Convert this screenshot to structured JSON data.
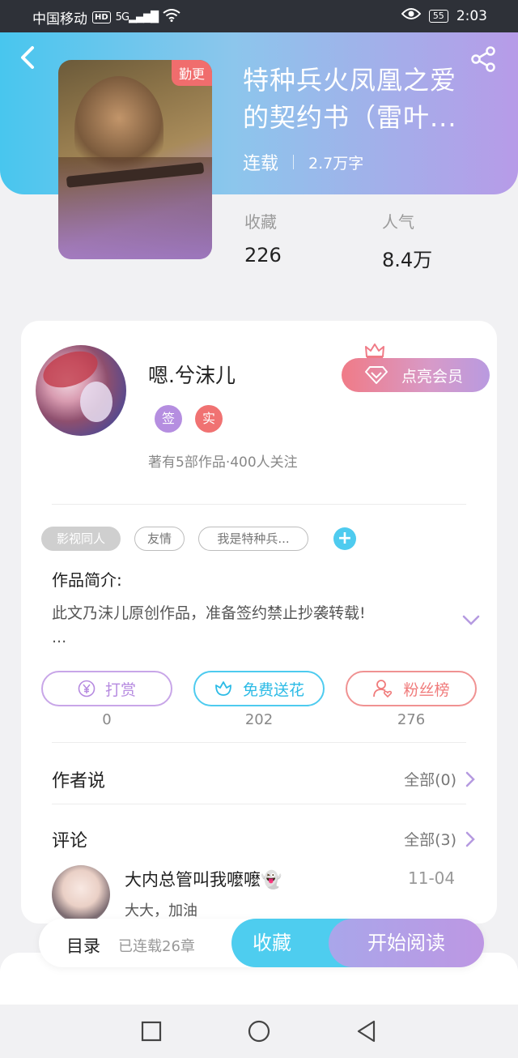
{
  "status_bar": {
    "carrier": "中国移动",
    "hd": "HD",
    "signal": "5G",
    "battery": "55",
    "time": "2:03"
  },
  "book": {
    "badge": "勤更",
    "title": "特种兵火凤凰之爱的契约书（雷叶...",
    "status": "连载",
    "word_count": "2.7万字",
    "stats": [
      {
        "label": "收藏",
        "value": "226"
      },
      {
        "label": "人气",
        "value": "8.4万"
      }
    ]
  },
  "author": {
    "name": "嗯.兮沫儿",
    "badges": [
      {
        "text": "签",
        "color": "#b58ee0"
      },
      {
        "text": "实",
        "color": "#f07272"
      }
    ],
    "stats": "著有5部作品·400人关注",
    "vip_label": "点亮会员"
  },
  "tags": [
    "影视同人",
    "友情",
    "我是特种兵..."
  ],
  "intro": {
    "title": "作品简介:",
    "text": "此文乃沫儿原创作品，准备签约禁止抄袭转载!",
    "ellipsis": "..."
  },
  "actions": [
    {
      "label": "打赏",
      "count": "0",
      "color": "#b68ae0"
    },
    {
      "label": "免费送花",
      "count": "202",
      "color": "#4ecbef"
    },
    {
      "label": "粉丝榜",
      "count": "276",
      "color": "#f07b7b"
    }
  ],
  "author_says": {
    "title": "作者说",
    "link": "全部(0)"
  },
  "comments": {
    "title": "评论",
    "link": "全部(3)",
    "items": [
      {
        "user": "大内总管叫我嚒嚒👻",
        "date": "11-04",
        "text": "大大，加油"
      }
    ]
  },
  "bottom": {
    "toc": "目录",
    "toc_sub": "已连载26章",
    "favorite": "收藏",
    "read": "开始阅读"
  },
  "colors": {
    "accent_blue": "#4ecdef",
    "accent_purple": "#b79be8",
    "badge_red": "#f06d6d"
  }
}
